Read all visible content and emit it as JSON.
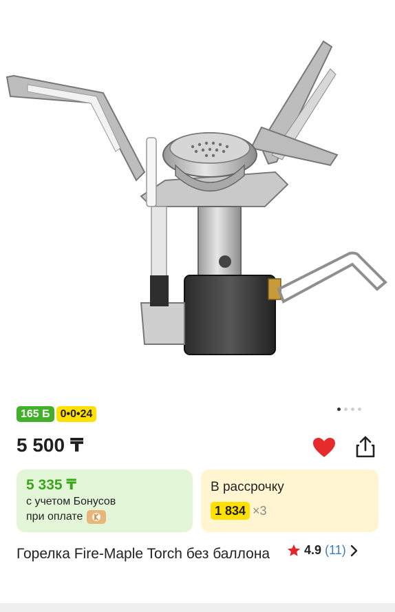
{
  "product": {
    "badges": {
      "bonus": "165 Б",
      "installment": "0•0•24"
    },
    "price": "5 500 ₸",
    "bonus_card": {
      "price": "5 335 ₸",
      "line1": "с учетом Бонусов",
      "line2": "при оплате"
    },
    "installment_card": {
      "title": "В рассрочку",
      "amount": "1 834",
      "multiplier": "×3"
    },
    "title": "Горелка Fire-Maple Torch без баллона",
    "rating": {
      "value": "4.9",
      "reviews": "(11)"
    },
    "gallery": {
      "dots": 4,
      "active_index": 0
    }
  },
  "colors": {
    "bonus_green": "#43b02a",
    "installment_yellow": "#ffe000",
    "heart_red": "#e52b2b",
    "star_red": "#e5262e",
    "link_blue": "#3a7cc2"
  },
  "icons": {
    "favorite": "heart-icon",
    "share": "share-icon",
    "star": "star-icon",
    "chevron": "chevron-right-icon",
    "payment": "kaspi-icon"
  }
}
